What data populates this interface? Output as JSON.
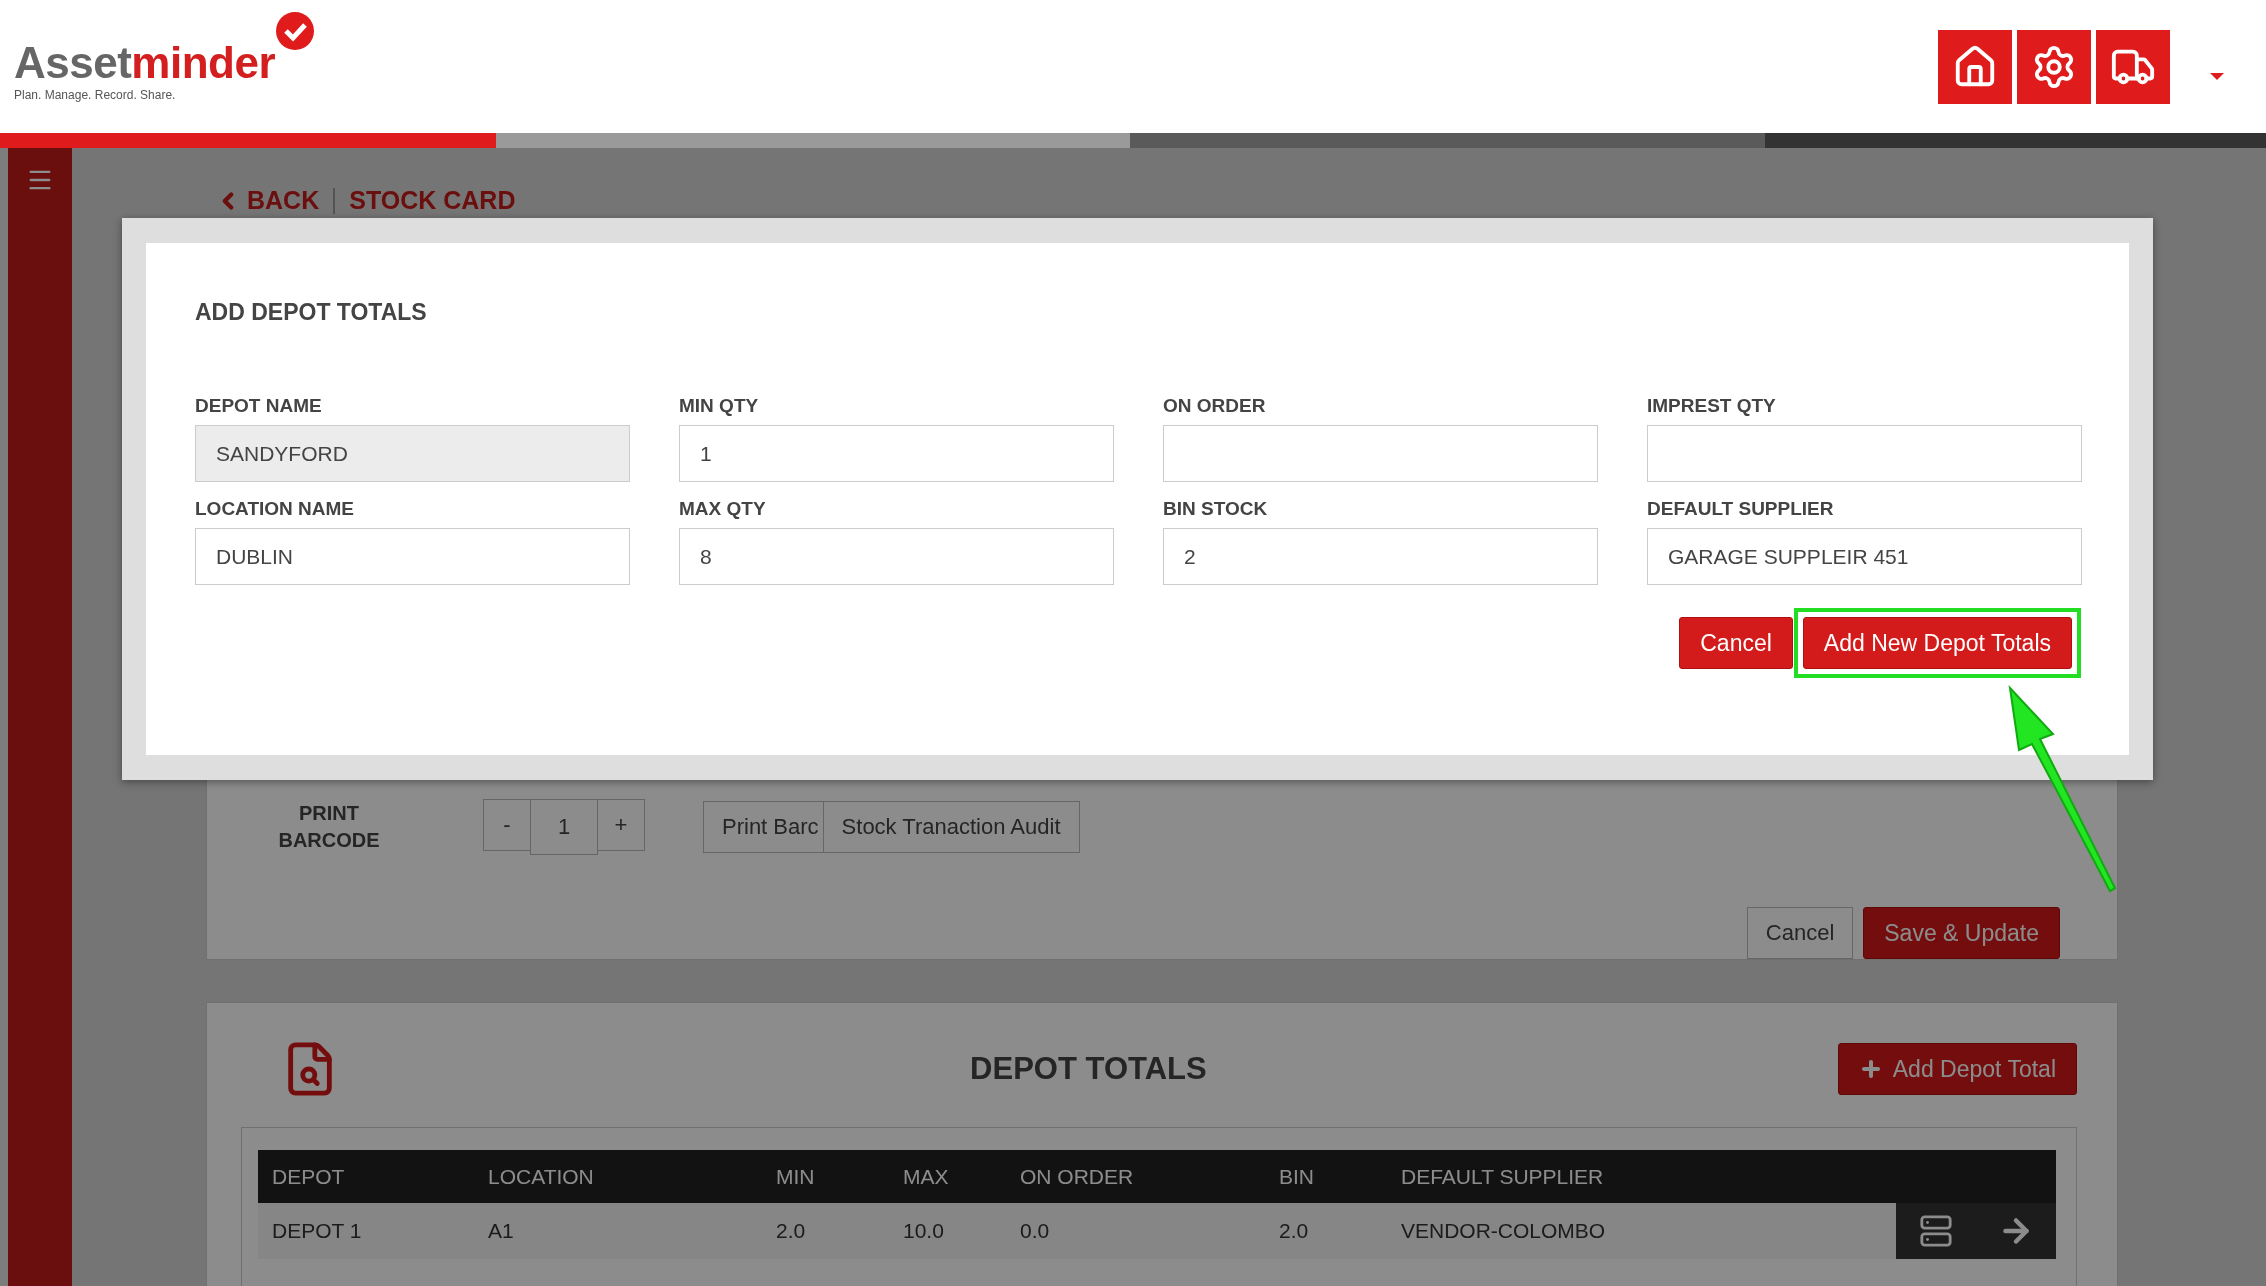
{
  "header": {
    "logo": {
      "wordmark_parts": [
        "Asset",
        "minder"
      ],
      "tagline": "Plan. Manage. Record. Share."
    }
  },
  "breadcrumb": {
    "back": "BACK",
    "current": "STOCK CARD"
  },
  "modal": {
    "title": "ADD DEPOT TOTALS",
    "fields": [
      {
        "label": "DEPOT NAME",
        "value": "SANDYFORD",
        "disabled": true
      },
      {
        "label": "MIN QTY",
        "value": "1",
        "disabled": false
      },
      {
        "label": "ON ORDER",
        "disabled": false
      },
      {
        "label": "IMPREST QTY",
        "disabled": false
      },
      {
        "label": "LOCATION NAME",
        "value": "DUBLIN",
        "disabled": false
      },
      {
        "label": "MAX QTY",
        "value": "8",
        "disabled": false
      },
      {
        "label": "BIN STOCK",
        "value": "2",
        "disabled": false
      },
      {
        "label": "DEFAULT SUPPLIER",
        "value": "GARAGE SUPPLEIR 451",
        "disabled": false
      }
    ],
    "buttons": [
      {
        "label": "Cancel",
        "highlighted": false
      },
      {
        "label": "Add New Depot Totals",
        "highlighted": true
      }
    ]
  },
  "stock_card": {
    "print_barcode_label": "PRINT BARCODE",
    "decrement": "-",
    "quantity": "1",
    "increment": "+",
    "print_button": "Print Barc",
    "audit_button": "Stock Tranaction Audit",
    "cancel": "Cancel",
    "save": "Save & Update"
  },
  "depot_totals": {
    "title": "DEPOT TOTALS",
    "add_button": "Add Depot Total",
    "table": {
      "columns": [
        "DEPOT",
        "LOCATION",
        "MIN",
        "MAX",
        "ON ORDER",
        "BIN",
        "DEFAULT SUPPLIER"
      ],
      "rows": [
        [
          "DEPOT 1",
          "A1",
          "2.0",
          "10.0",
          "0.0",
          "2.0",
          "VENDOR-COLOMBO"
        ]
      ]
    }
  }
}
